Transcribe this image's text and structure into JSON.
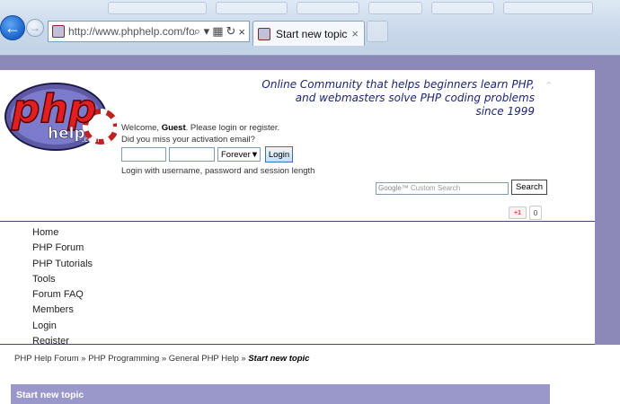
{
  "browser": {
    "back_label": "←",
    "forward_label": "→",
    "address_url": "http://www.phphelp.com/fo",
    "tab_title": "Start new topic",
    "tab_close": "×",
    "tools": [
      "⌕ ▾",
      "▦",
      "↻",
      "×"
    ]
  },
  "site": {
    "logo_text": "php",
    "logo_sub": "help",
    "logo_com": ".com",
    "tagline_line1": "Online Community that helps beginners learn PHP,",
    "tagline_line2": "and webmasters solve PHP coding problems",
    "tagline_line3": "since 1999"
  },
  "login": {
    "welcome_prefix": "Welcome, ",
    "guest": "Guest",
    "welcome_suffix": ". Please login or register.",
    "activation": "Did you miss your activation email?",
    "duration": "Forever",
    "login_button": "Login",
    "hint": "Login with username, password and session length"
  },
  "search": {
    "placeholder": "Custom Search",
    "google": "Google™",
    "button": "Search"
  },
  "social": {
    "gplus": "+1",
    "count": "0"
  },
  "menu": {
    "items": [
      "Home",
      "PHP Forum",
      "PHP Tutorials",
      "Tools",
      "Forum FAQ",
      "Members",
      "Login",
      "Register"
    ]
  },
  "breadcrumb": {
    "items": [
      "PHP Help Forum",
      "PHP Programming",
      "General PHP Help"
    ],
    "separator": " » ",
    "current": "Start new topic"
  },
  "topic_bar": {
    "title": "Start new topic"
  }
}
